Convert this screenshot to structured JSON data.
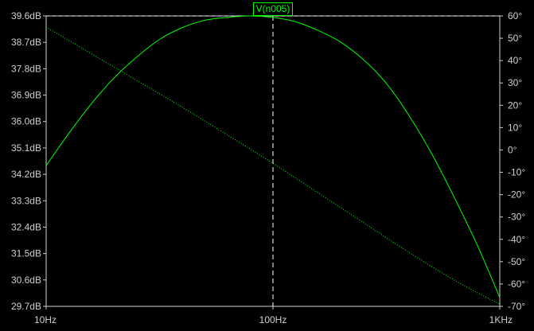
{
  "chart_data": {
    "type": "line",
    "title": "V(n005)",
    "x_scale": "log",
    "xlim": [
      10,
      1000
    ],
    "x_ticks": [
      {
        "value": 10,
        "label": "10Hz"
      },
      {
        "value": 100,
        "label": "100Hz"
      },
      {
        "value": 1000,
        "label": "1KHz"
      }
    ],
    "ylim_left": [
      29.7,
      39.6
    ],
    "left_ticks": [
      {
        "value": 39.6,
        "label": "39.6dB"
      },
      {
        "value": 38.7,
        "label": "38.7dB"
      },
      {
        "value": 37.8,
        "label": "37.8dB"
      },
      {
        "value": 36.9,
        "label": "36.9dB"
      },
      {
        "value": 36.0,
        "label": "36.0dB"
      },
      {
        "value": 35.1,
        "label": "35.1dB"
      },
      {
        "value": 34.2,
        "label": "34.2dB"
      },
      {
        "value": 33.3,
        "label": "33.3dB"
      },
      {
        "value": 32.4,
        "label": "32.4dB"
      },
      {
        "value": 31.5,
        "label": "31.5dB"
      },
      {
        "value": 30.6,
        "label": "30.6dB"
      },
      {
        "value": 29.7,
        "label": "29.7dB"
      }
    ],
    "ylim_right": [
      -70,
      60
    ],
    "right_ticks": [
      {
        "value": 60,
        "label": "60°"
      },
      {
        "value": 50,
        "label": "50°"
      },
      {
        "value": 40,
        "label": "40°"
      },
      {
        "value": 30,
        "label": "30°"
      },
      {
        "value": 20,
        "label": "20°"
      },
      {
        "value": 10,
        "label": "10°"
      },
      {
        "value": 0,
        "label": "0°"
      },
      {
        "value": -10,
        "label": "-10°"
      },
      {
        "value": -20,
        "label": "-20°"
      },
      {
        "value": -30,
        "label": "-30°"
      },
      {
        "value": -40,
        "label": "-40°"
      },
      {
        "value": -50,
        "label": "-50°"
      },
      {
        "value": -60,
        "label": "-60°"
      },
      {
        "value": -70,
        "label": "-70°"
      }
    ],
    "cursor": {
      "x": 100,
      "y_db": 39.6
    },
    "series": [
      {
        "style": "solid",
        "axis": "left",
        "color": "#00ff00",
        "x": [
          10,
          12.6,
          15.8,
          20,
          25.1,
          31.6,
          39.8,
          50.1,
          63.1,
          79.4,
          100,
          125.9,
          158.5,
          199.5,
          251.2,
          316.2,
          398.1,
          501.2,
          631,
          794.3,
          1000
        ],
        "y": [
          34.5,
          35.6,
          36.6,
          37.5,
          38.2,
          38.8,
          39.2,
          39.45,
          39.55,
          39.6,
          39.55,
          39.4,
          39.1,
          38.7,
          38.1,
          37.3,
          36.2,
          34.9,
          33.4,
          31.8,
          30.0
        ]
      },
      {
        "style": "dotted",
        "axis": "right",
        "color": "#00ff00",
        "x": [
          10,
          20,
          40,
          60,
          100,
          200,
          400,
          600,
          800,
          1000
        ],
        "y": [
          55,
          37,
          19,
          8,
          -6,
          -26,
          -46,
          -57,
          -64,
          -69
        ]
      }
    ]
  }
}
